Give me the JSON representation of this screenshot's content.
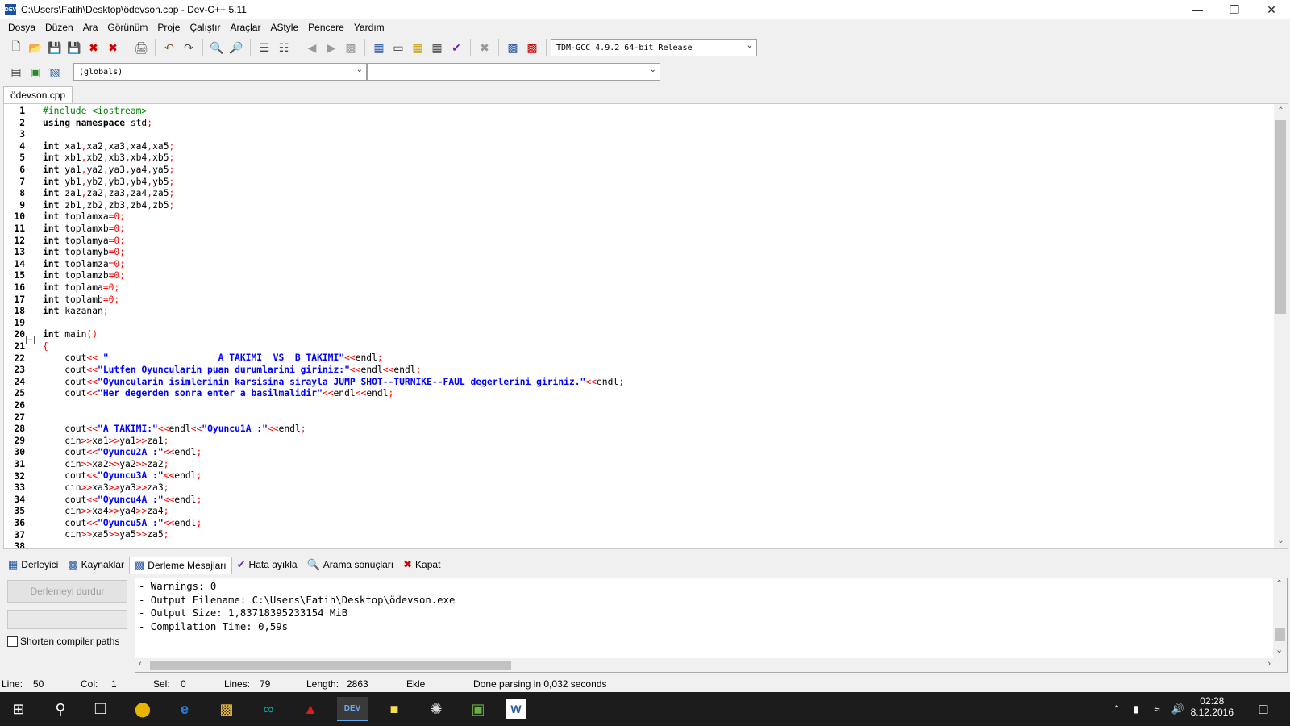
{
  "window": {
    "title": "C:\\Users\\Fatih\\Desktop\\ödevson.cpp - Dev-C++ 5.11",
    "icon": "DEV"
  },
  "menu": [
    "Dosya",
    "Düzen",
    "Ara",
    "Görünüm",
    "Proje",
    "Çalıştır",
    "Araçlar",
    "AStyle",
    "Pencere",
    "Yardım"
  ],
  "toolbar": {
    "compiler_select": "TDM-GCC 4.9.2 64-bit Release",
    "scope_select": "(globals)",
    "member_select": ""
  },
  "file_tab": "ödevson.cpp",
  "code_lines": [
    [
      [
        "pp",
        "#include <iostream>"
      ]
    ],
    [
      [
        "kw",
        "using namespace"
      ],
      [
        "id",
        " std"
      ],
      [
        "sym",
        ";"
      ]
    ],
    [],
    [
      [
        "kw",
        "int"
      ],
      [
        "id",
        " xa1"
      ],
      [
        "sym",
        ","
      ],
      [
        "id",
        "xa2"
      ],
      [
        "sym",
        ","
      ],
      [
        "id",
        "xa3"
      ],
      [
        "sym",
        ","
      ],
      [
        "id",
        "xa4"
      ],
      [
        "sym",
        ","
      ],
      [
        "id",
        "xa5"
      ],
      [
        "sym",
        ";"
      ]
    ],
    [
      [
        "kw",
        "int"
      ],
      [
        "id",
        " xb1"
      ],
      [
        "sym",
        ","
      ],
      [
        "id",
        "xb2"
      ],
      [
        "sym",
        ","
      ],
      [
        "id",
        "xb3"
      ],
      [
        "sym",
        ","
      ],
      [
        "id",
        "xb4"
      ],
      [
        "sym",
        ","
      ],
      [
        "id",
        "xb5"
      ],
      [
        "sym",
        ";"
      ]
    ],
    [
      [
        "kw",
        "int"
      ],
      [
        "id",
        " ya1"
      ],
      [
        "sym",
        ","
      ],
      [
        "id",
        "ya2"
      ],
      [
        "sym",
        ","
      ],
      [
        "id",
        "ya3"
      ],
      [
        "sym",
        ","
      ],
      [
        "id",
        "ya4"
      ],
      [
        "sym",
        ","
      ],
      [
        "id",
        "ya5"
      ],
      [
        "sym",
        ";"
      ]
    ],
    [
      [
        "kw",
        "int"
      ],
      [
        "id",
        " yb1"
      ],
      [
        "sym",
        ","
      ],
      [
        "id",
        "yb2"
      ],
      [
        "sym",
        ","
      ],
      [
        "id",
        "yb3"
      ],
      [
        "sym",
        ","
      ],
      [
        "id",
        "yb4"
      ],
      [
        "sym",
        ","
      ],
      [
        "id",
        "yb5"
      ],
      [
        "sym",
        ";"
      ]
    ],
    [
      [
        "kw",
        "int"
      ],
      [
        "id",
        " za1"
      ],
      [
        "sym",
        ","
      ],
      [
        "id",
        "za2"
      ],
      [
        "sym",
        ","
      ],
      [
        "id",
        "za3"
      ],
      [
        "sym",
        ","
      ],
      [
        "id",
        "za4"
      ],
      [
        "sym",
        ","
      ],
      [
        "id",
        "za5"
      ],
      [
        "sym",
        ";"
      ]
    ],
    [
      [
        "kw",
        "int"
      ],
      [
        "id",
        " zb1"
      ],
      [
        "sym",
        ","
      ],
      [
        "id",
        "zb2"
      ],
      [
        "sym",
        ","
      ],
      [
        "id",
        "zb3"
      ],
      [
        "sym",
        ","
      ],
      [
        "id",
        "zb4"
      ],
      [
        "sym",
        ","
      ],
      [
        "id",
        "zb5"
      ],
      [
        "sym",
        ";"
      ]
    ],
    [
      [
        "kw",
        "int"
      ],
      [
        "id",
        " toplamxa"
      ],
      [
        "sym",
        "=0;"
      ]
    ],
    [
      [
        "kw",
        "int"
      ],
      [
        "id",
        " toplamxb"
      ],
      [
        "sym",
        "=0;"
      ]
    ],
    [
      [
        "kw",
        "int"
      ],
      [
        "id",
        " toplamya"
      ],
      [
        "sym",
        "=0;"
      ]
    ],
    [
      [
        "kw",
        "int"
      ],
      [
        "id",
        " toplamyb"
      ],
      [
        "sym",
        "=0;"
      ]
    ],
    [
      [
        "kw",
        "int"
      ],
      [
        "id",
        " toplamza"
      ],
      [
        "sym",
        "=0;"
      ]
    ],
    [
      [
        "kw",
        "int"
      ],
      [
        "id",
        " toplamzb"
      ],
      [
        "sym",
        "=0;"
      ]
    ],
    [
      [
        "kw",
        "int"
      ],
      [
        "id",
        " toplama"
      ],
      [
        "sym",
        "=0;"
      ]
    ],
    [
      [
        "kw",
        "int"
      ],
      [
        "id",
        " toplamb"
      ],
      [
        "sym",
        "=0;"
      ]
    ],
    [
      [
        "kw",
        "int"
      ],
      [
        "id",
        " kazanan"
      ],
      [
        "sym",
        ";"
      ]
    ],
    [],
    [
      [
        "kw",
        "int"
      ],
      [
        "id",
        " main"
      ],
      [
        "sym",
        "()"
      ]
    ],
    [
      [
        "sym",
        "{"
      ]
    ],
    [
      [
        "id",
        "    cout"
      ],
      [
        "sym",
        "<< "
      ],
      [
        "str",
        "\"                    A TAKIMI  VS  B TAKIMI\""
      ],
      [
        "sym",
        "<<"
      ],
      [
        "id",
        "endl"
      ],
      [
        "sym",
        ";"
      ]
    ],
    [
      [
        "id",
        "    cout"
      ],
      [
        "sym",
        "<<"
      ],
      [
        "str",
        "\"Lutfen Oyuncularin puan durumlarini giriniz:\""
      ],
      [
        "sym",
        "<<"
      ],
      [
        "id",
        "endl"
      ],
      [
        "sym",
        "<<"
      ],
      [
        "id",
        "endl"
      ],
      [
        "sym",
        ";"
      ]
    ],
    [
      [
        "id",
        "    cout"
      ],
      [
        "sym",
        "<<"
      ],
      [
        "str",
        "\"Oyuncularin isimlerinin karsisina sirayla JUMP SHOT--TURNIKE--FAUL degerlerini giriniz.\""
      ],
      [
        "sym",
        "<<"
      ],
      [
        "id",
        "endl"
      ],
      [
        "sym",
        ";"
      ]
    ],
    [
      [
        "id",
        "    cout"
      ],
      [
        "sym",
        "<<"
      ],
      [
        "str",
        "\"Her degerden sonra enter a basilmalidir\""
      ],
      [
        "sym",
        "<<"
      ],
      [
        "id",
        "endl"
      ],
      [
        "sym",
        "<<"
      ],
      [
        "id",
        "endl"
      ],
      [
        "sym",
        ";"
      ]
    ],
    [],
    [],
    [
      [
        "id",
        "    cout"
      ],
      [
        "sym",
        "<<"
      ],
      [
        "str",
        "\"A TAKIMI:\""
      ],
      [
        "sym",
        "<<"
      ],
      [
        "id",
        "endl"
      ],
      [
        "sym",
        "<<"
      ],
      [
        "str",
        "\"Oyuncu1A :\""
      ],
      [
        "sym",
        "<<"
      ],
      [
        "id",
        "endl"
      ],
      [
        "sym",
        ";"
      ]
    ],
    [
      [
        "id",
        "    cin"
      ],
      [
        "sym",
        ">>"
      ],
      [
        "id",
        "xa1"
      ],
      [
        "sym",
        ">>"
      ],
      [
        "id",
        "ya1"
      ],
      [
        "sym",
        ">>"
      ],
      [
        "id",
        "za1"
      ],
      [
        "sym",
        ";"
      ]
    ],
    [
      [
        "id",
        "    cout"
      ],
      [
        "sym",
        "<<"
      ],
      [
        "str",
        "\"Oyuncu2A :\""
      ],
      [
        "sym",
        "<<"
      ],
      [
        "id",
        "endl"
      ],
      [
        "sym",
        ";"
      ]
    ],
    [
      [
        "id",
        "    cin"
      ],
      [
        "sym",
        ">>"
      ],
      [
        "id",
        "xa2"
      ],
      [
        "sym",
        ">>"
      ],
      [
        "id",
        "ya2"
      ],
      [
        "sym",
        ">>"
      ],
      [
        "id",
        "za2"
      ],
      [
        "sym",
        ";"
      ]
    ],
    [
      [
        "id",
        "    cout"
      ],
      [
        "sym",
        "<<"
      ],
      [
        "str",
        "\"Oyuncu3A :\""
      ],
      [
        "sym",
        "<<"
      ],
      [
        "id",
        "endl"
      ],
      [
        "sym",
        ";"
      ]
    ],
    [
      [
        "id",
        "    cin"
      ],
      [
        "sym",
        ">>"
      ],
      [
        "id",
        "xa3"
      ],
      [
        "sym",
        ">>"
      ],
      [
        "id",
        "ya3"
      ],
      [
        "sym",
        ">>"
      ],
      [
        "id",
        "za3"
      ],
      [
        "sym",
        ";"
      ]
    ],
    [
      [
        "id",
        "    cout"
      ],
      [
        "sym",
        "<<"
      ],
      [
        "str",
        "\"Oyuncu4A :\""
      ],
      [
        "sym",
        "<<"
      ],
      [
        "id",
        "endl"
      ],
      [
        "sym",
        ";"
      ]
    ],
    [
      [
        "id",
        "    cin"
      ],
      [
        "sym",
        ">>"
      ],
      [
        "id",
        "xa4"
      ],
      [
        "sym",
        ">>"
      ],
      [
        "id",
        "ya4"
      ],
      [
        "sym",
        ">>"
      ],
      [
        "id",
        "za4"
      ],
      [
        "sym",
        ";"
      ]
    ],
    [
      [
        "id",
        "    cout"
      ],
      [
        "sym",
        "<<"
      ],
      [
        "str",
        "\"Oyuncu5A :\""
      ],
      [
        "sym",
        "<<"
      ],
      [
        "id",
        "endl"
      ],
      [
        "sym",
        ";"
      ]
    ],
    [
      [
        "id",
        "    cin"
      ],
      [
        "sym",
        ">>"
      ],
      [
        "id",
        "xa5"
      ],
      [
        "sym",
        ">>"
      ],
      [
        "id",
        "ya5"
      ],
      [
        "sym",
        ">>"
      ],
      [
        "id",
        "za5"
      ],
      [
        "sym",
        ";"
      ]
    ],
    []
  ],
  "bottom_tabs": [
    {
      "label": "Derleyici",
      "icon": "compiler-icon"
    },
    {
      "label": "Kaynaklar",
      "icon": "resources-icon"
    },
    {
      "label": "Derleme Mesajları",
      "icon": "chart-icon",
      "active": true
    },
    {
      "label": "Hata ayıkla",
      "icon": "check-icon"
    },
    {
      "label": "Arama sonuçları",
      "icon": "search-icon"
    },
    {
      "label": "Kapat",
      "icon": "close-icon"
    }
  ],
  "compile": {
    "stop_button": "Derlemeyi durdur",
    "shorten_paths": "Shorten compiler paths",
    "output_lines": [
      "- Warnings: 0",
      "- Output Filename: C:\\Users\\Fatih\\Desktop\\ödevson.exe",
      "- Output Size: 1,83718395233154 MiB",
      "- Compilation Time: 0,59s"
    ]
  },
  "status": {
    "line_label": "Line:",
    "line_value": "50",
    "col_label": "Col:",
    "col_value": "1",
    "sel_label": "Sel:",
    "sel_value": "0",
    "lines_label": "Lines:",
    "lines_value": "79",
    "length_label": "Length:",
    "length_value": "2863",
    "mode": "Ekle",
    "message": "Done parsing in 0,032 seconds"
  },
  "taskbar": {
    "time": "02:28",
    "date": "8.12.2016"
  }
}
